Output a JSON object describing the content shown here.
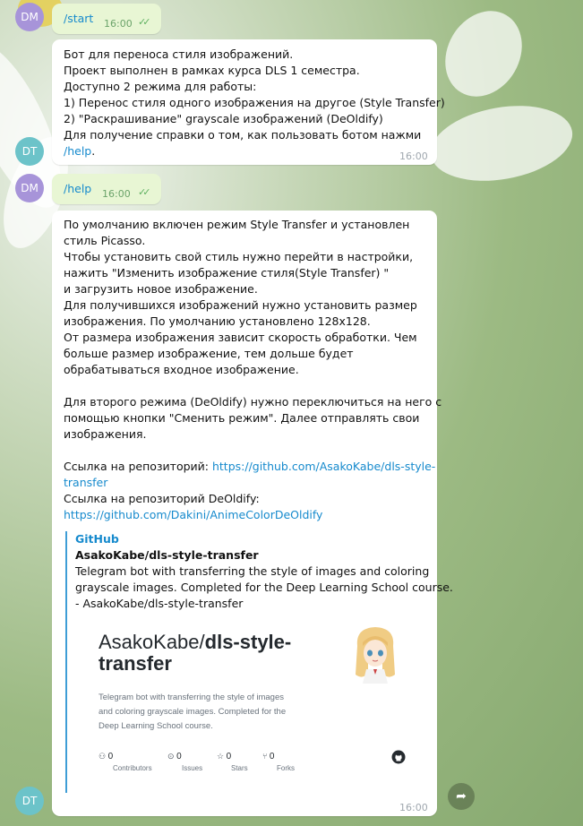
{
  "messages": {
    "start": {
      "sender_initials": "DM",
      "text": "/start",
      "time": "16:00"
    },
    "bot_intro": {
      "sender_initials": "DT",
      "lines": [
        "Бот для переноса стиля изображений.",
        "Проект выполнен в рамках курса DLS 1 семестра.",
        "Доступно 2 режима для работы:",
        "1) Перенос стиля одного изображения на другое (Style Transfer)",
        "2) \"Раскрашивание\" grayscale изображений (DeOldify)",
        "Для получение справки о том, как пользовать ботом нажми"
      ],
      "help_link": "/help",
      "help_suffix": ".",
      "time": "16:00"
    },
    "help_cmd": {
      "sender_initials": "DM",
      "text": "/help",
      "time": "16:00"
    },
    "bot_help": {
      "sender_initials": "DT",
      "lines": [
        "По умолчанию включен режим Style Transfer и установлен",
        "стиль Picasso.",
        "Чтобы установить свой стиль нужно перейти в настройки,",
        "нажить \"Изменить изображение стиля(Style Transfer) \"",
        "и загрузить новое изображение.",
        "Для получившихся изображений нужно установить размер",
        "изображения. По умолчанию установлено 128x128.",
        "От размера изображения зависит скорость обработки. Чем",
        "больше размер изображение, тем дольше будет",
        "обрабатываться входное изображение.",
        "",
        "Для второго режима (DeOldify) нужно переключиться на него с",
        "помощью кнопки \"Сменить режим\". Далее отправлять свои",
        "изображения.",
        ""
      ],
      "repo_label": "Ссылка на репозиторий: ",
      "repo_link_1": "https://github.com/AsakoKabe/dls-style-",
      "repo_link_2": "transfer",
      "deoldify_label": "Ссылка на репозиторий DeOldify:",
      "deoldify_link": "https://github.com/Dakini/AnimeColorDeOldify",
      "preview": {
        "site": "GitHub",
        "title": "AsakoKabe/dls-style-transfer",
        "desc_lines": [
          "Telegram bot with transferring the style of images and coloring",
          "grayscale images. Completed for the Deep Learning School course.",
          "- AsakoKabe/dls-style-transfer"
        ],
        "card": {
          "owner": "AsakoKabe/",
          "repo_1": "dls-style-",
          "repo_2": "transfer",
          "desc_lines": [
            "Telegram bot with transferring the style of images",
            "and coloring grayscale images. Completed for the",
            "Deep Learning School course."
          ],
          "stats": [
            {
              "icon": "contributors-icon",
              "value": "0",
              "label": "Contributors"
            },
            {
              "icon": "issues-icon",
              "value": "0",
              "label": "Issues"
            },
            {
              "icon": "stars-icon",
              "value": "0",
              "label": "Stars"
            },
            {
              "icon": "forks-icon",
              "value": "0",
              "label": "Forks"
            }
          ]
        }
      },
      "time": "16:00"
    }
  },
  "colors": {
    "outgoing_bubble": "#e8f6d4",
    "incoming_bubble": "#ffffff",
    "link": "#168acd",
    "avatar_dm": "#a794d9",
    "avatar_dt": "#6cc3c9"
  }
}
